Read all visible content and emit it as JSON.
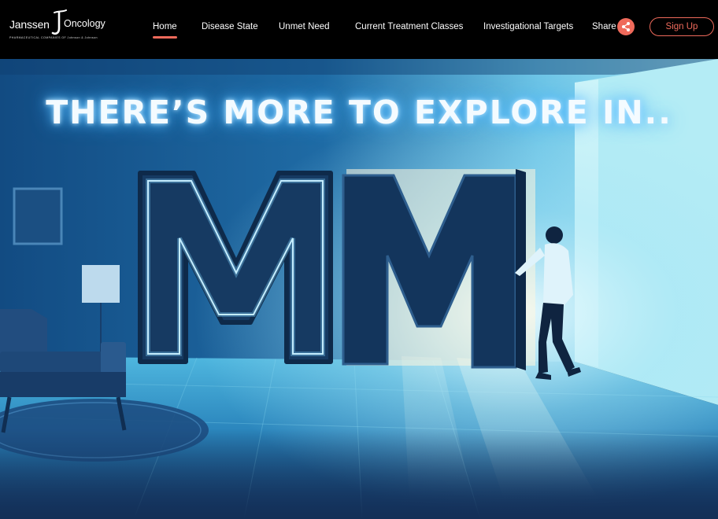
{
  "brand": {
    "name_left": "Janssen",
    "name_right": "Oncology",
    "tagline": "PHARMACEUTICAL COMPANIES OF Johnson & Johnson"
  },
  "nav": {
    "items": [
      {
        "label": "Home",
        "active": true
      },
      {
        "label": "Disease State",
        "active": false
      },
      {
        "label": "Unmet Need",
        "active": false
      },
      {
        "label": "Current Treatment Classes",
        "active": false
      },
      {
        "label": "Investigational Targets",
        "active": false
      }
    ],
    "share_label": "Share",
    "signup_label": "Sign Up"
  },
  "hero": {
    "title": "THERE’S MORE TO EXPLORE IN..",
    "letters": "MM"
  },
  "colors": {
    "accent": "#ef6a5b",
    "header_bg": "#000000",
    "hero_deep": "#143f70",
    "hero_glow": "#e6fbff"
  }
}
